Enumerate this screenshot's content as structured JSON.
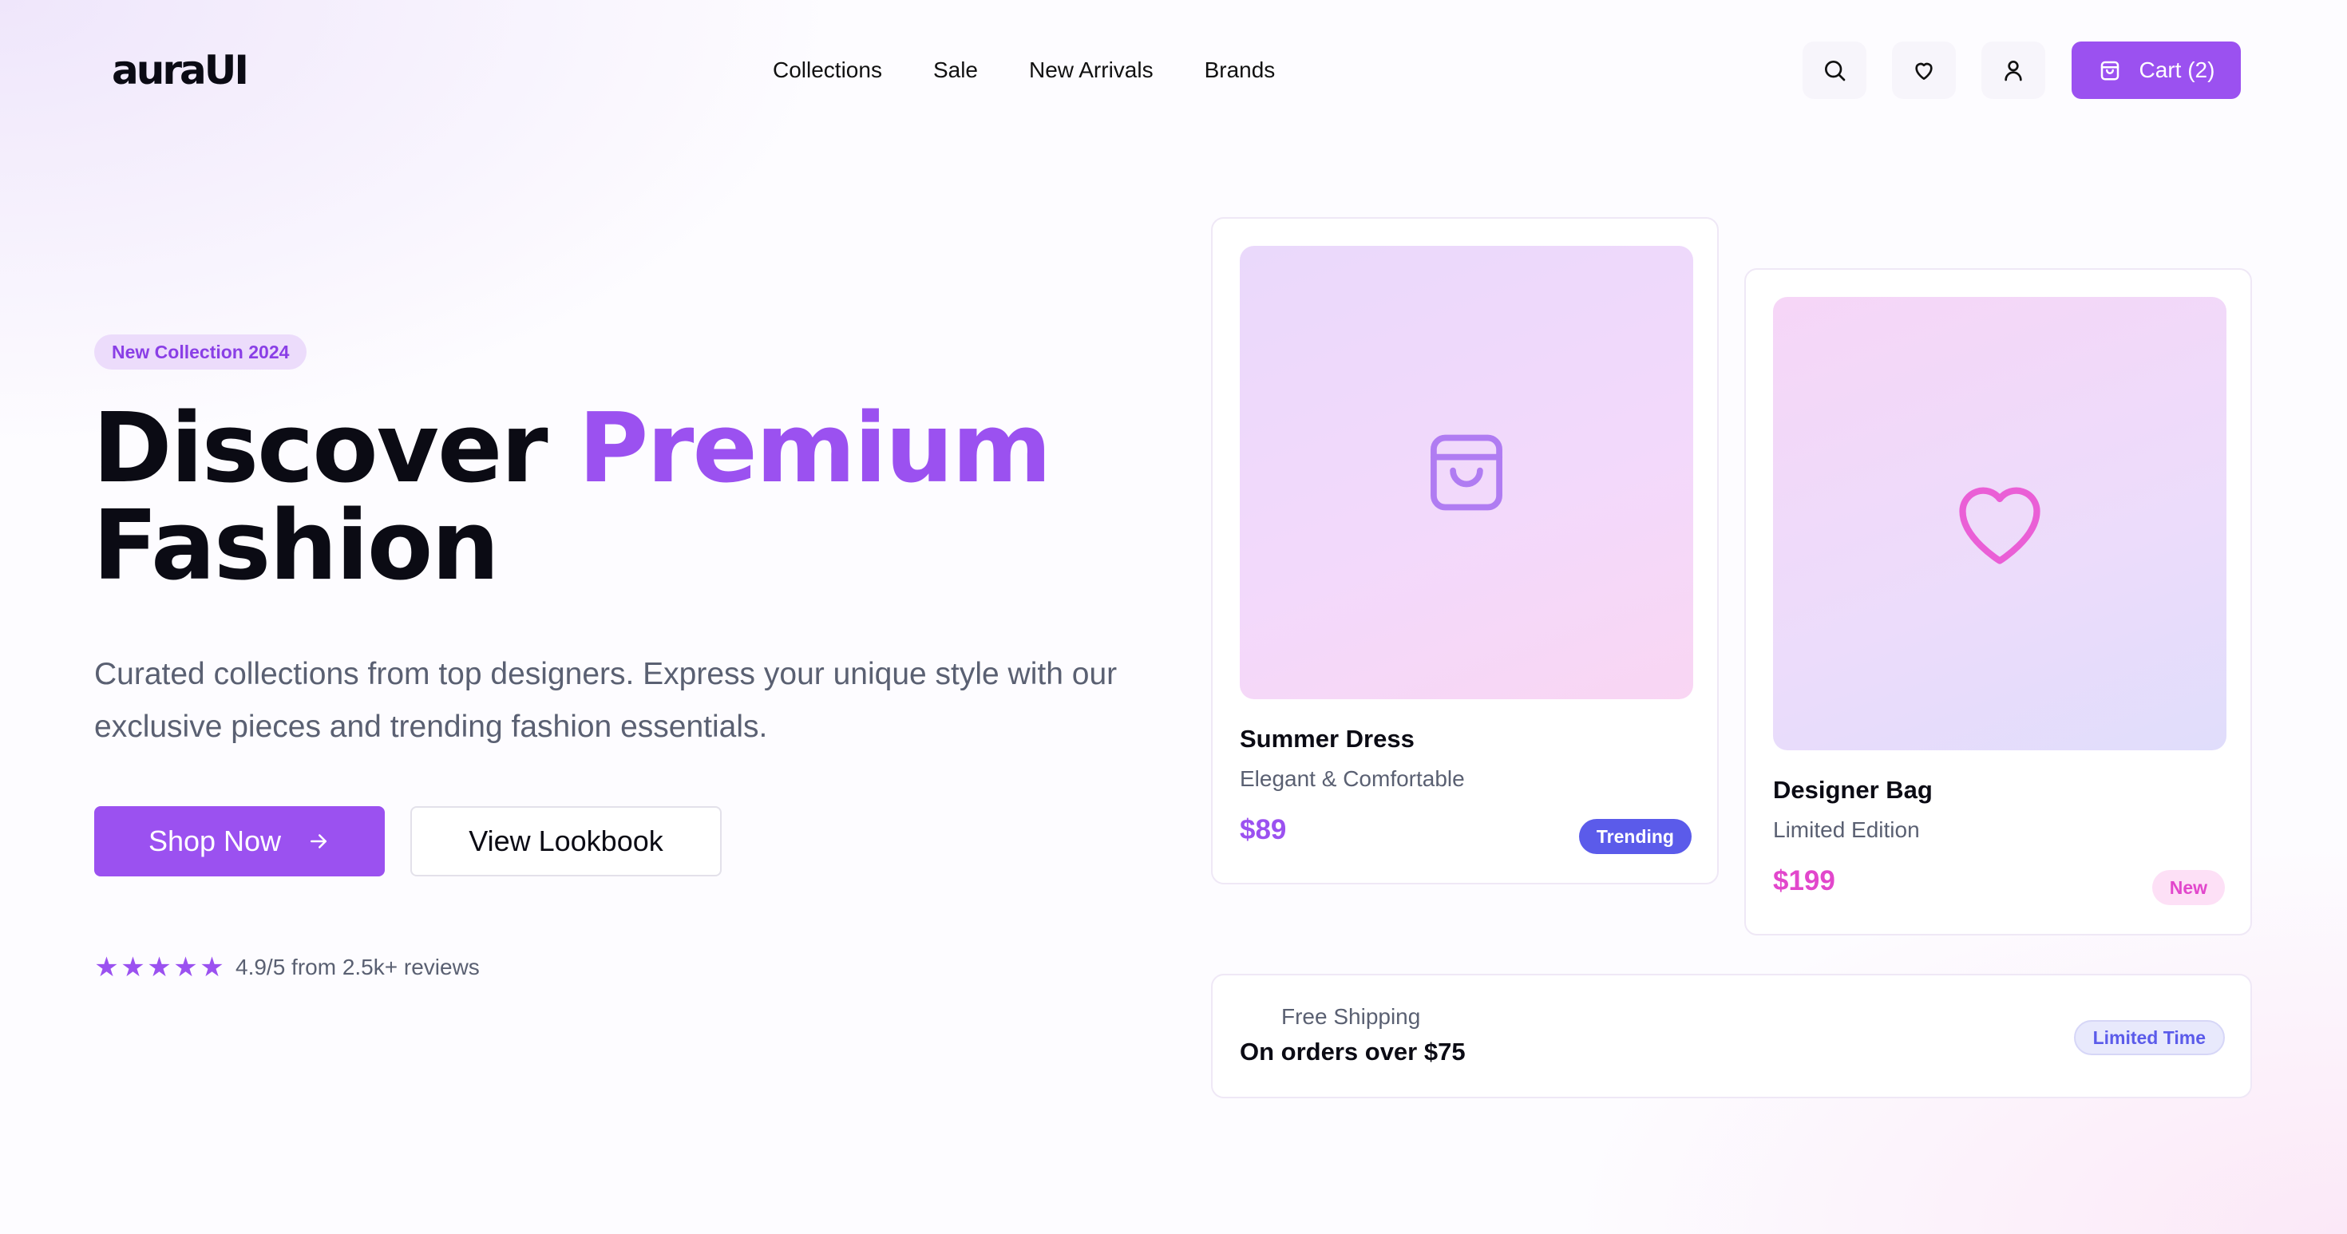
{
  "brand": {
    "logo": "auraUI"
  },
  "nav": {
    "items": [
      "Collections",
      "Sale",
      "New Arrivals",
      "Brands"
    ]
  },
  "header": {
    "icons": [
      "search-icon",
      "heart-icon",
      "user-icon"
    ],
    "cart_label": "Cart (2)"
  },
  "hero": {
    "badge": "New Collection 2024",
    "title_part1": "Discover",
    "title_accent": "Premium",
    "title_part2": "Fashion",
    "subtitle": "Curated collections from top designers. Express your unique style with our exclusive pieces and trending fashion essentials.",
    "primary_button": "Shop Now",
    "secondary_button": "View Lookbook",
    "rating": {
      "stars": 5,
      "text": "4.9/5 from 2.5k+ reviews"
    }
  },
  "products": [
    {
      "name": "Summer Dress",
      "description": "Elegant & Comfortable",
      "price": "$89",
      "tag": "Trending",
      "icon": "shopping-bag-icon"
    },
    {
      "name": "Designer Bag",
      "description": "Limited Edition",
      "price": "$199",
      "tag": "New",
      "icon": "heart-icon"
    }
  ],
  "shipping": {
    "label": "Free Shipping",
    "value": "On orders over $75",
    "tag": "Limited Time"
  },
  "colors": {
    "accent": "#9b51f0",
    "pink": "#e247cc",
    "indigo": "#5b5bea",
    "text": "#0b0b14",
    "muted": "#5a6072"
  }
}
